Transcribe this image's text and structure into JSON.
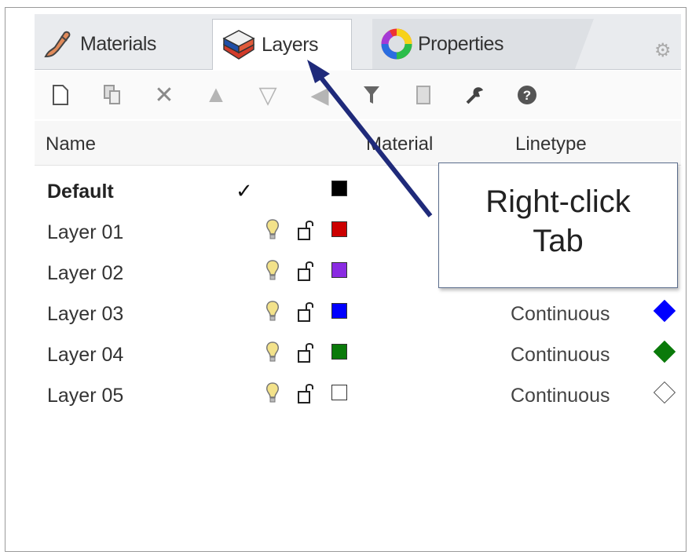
{
  "tabs": [
    {
      "label": "Materials",
      "icon": "materials-brush-icon"
    },
    {
      "label": "Layers",
      "icon": "layers-icon",
      "active": true
    },
    {
      "label": "Properties",
      "icon": "properties-ring-icon"
    }
  ],
  "toolbar": {
    "items": [
      "new-layer-icon",
      "new-sublayer-icon",
      "delete-icon",
      "move-up-icon",
      "move-down-icon",
      "move-left-icon",
      "filter-icon",
      "document-icon",
      "tools-icon",
      "help-icon"
    ]
  },
  "columns": {
    "name": "Name",
    "material": "Material",
    "linetype": "Linetype"
  },
  "layers": [
    {
      "name": "Default",
      "current": true,
      "color": "#000000",
      "linetype": "",
      "print_color": ""
    },
    {
      "name": "Layer 01",
      "current": false,
      "color": "#cc0000",
      "linetype": "",
      "print_color": ""
    },
    {
      "name": "Layer 02",
      "current": false,
      "color": "#8a2be2",
      "linetype": "",
      "print_color": ""
    },
    {
      "name": "Layer 03",
      "current": false,
      "color": "#0000ff",
      "linetype": "Continuous",
      "print_color": "#0000ff"
    },
    {
      "name": "Layer 04",
      "current": false,
      "color": "#0a7a0a",
      "linetype": "Continuous",
      "print_color": "#0a7a0a"
    },
    {
      "name": "Layer 05",
      "current": false,
      "color": "#ffffff",
      "linetype": "Continuous",
      "print_color": "#ffffff"
    }
  ],
  "callout": {
    "line1": "Right-click",
    "line2": "Tab"
  },
  "colors": {
    "arrow": "#1f2a7a",
    "bulb": "#f3e28a"
  }
}
